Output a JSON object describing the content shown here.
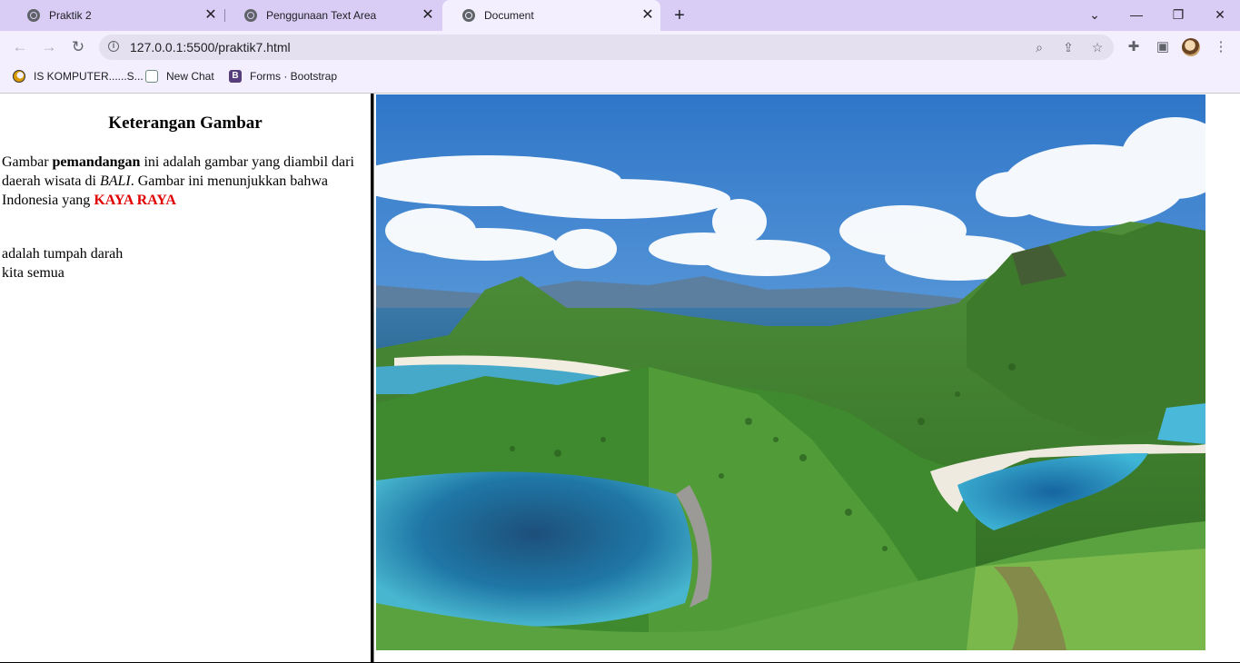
{
  "tabs": [
    {
      "title": "Praktik 2"
    },
    {
      "title": "Penggunaan Text Area"
    },
    {
      "title": "Document"
    }
  ],
  "address_bar": {
    "url": "127.0.0.1:5500/praktik7.html"
  },
  "bookmarks": [
    {
      "label": "IS KOMPUTER......S..."
    },
    {
      "label": "New Chat"
    },
    {
      "label": "Forms · Bootstrap"
    }
  ],
  "page": {
    "heading": "Keterangan Gambar",
    "para1_a": "Gambar ",
    "para1_bold": "pemandangan",
    "para1_b": " ini adalah gambar yang diambil dari daerah wisata di ",
    "para1_italic": "BALI",
    "para1_c": ". Gambar ini menunjukkan bahwa",
    "para1_d": "Indonesia yang ",
    "para1_red": "KAYA RAYA",
    "para2_line1": "adalah tumpah darah",
    "para2_line2": "kita semua"
  },
  "colors": {
    "accent_red": "#e00000",
    "tabstrip": "#d9ccf5",
    "toolbar": "#f3efff"
  },
  "icons": [
    "globe-icon",
    "close-icon",
    "plus-icon",
    "chevron-down-icon",
    "minimize-icon",
    "restore-icon",
    "back-icon",
    "forward-icon",
    "reload-icon",
    "info-icon",
    "zoom-icon",
    "share-icon",
    "star-icon",
    "extensions-icon",
    "side-panel-icon",
    "menu-icon"
  ]
}
